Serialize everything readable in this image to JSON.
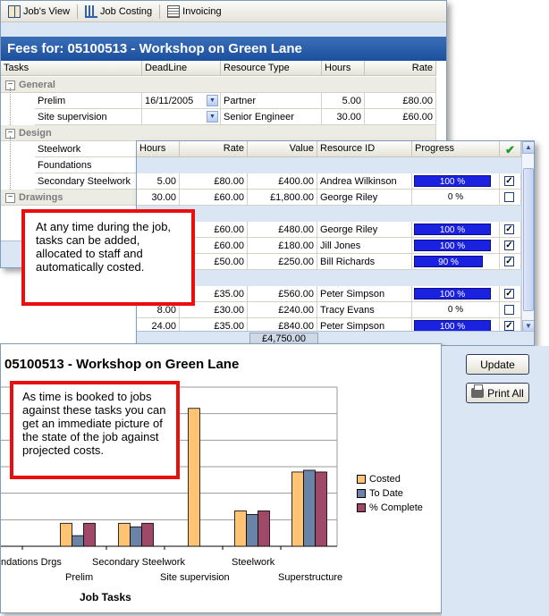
{
  "toolbar": {
    "jobs_view": "Job's View",
    "job_costing": "Job Costing",
    "invoicing": "Invoicing"
  },
  "fees": {
    "title": "Fees for:  05100513 - Workshop on Green Lane"
  },
  "job_grid": {
    "headers": {
      "tasks": "Tasks",
      "deadline": "DeadLine",
      "resource_type": "Resource Type",
      "hours": "Hours",
      "rate": "Rate"
    },
    "groups": {
      "general": "General",
      "design": "Design",
      "drawings": "Drawings"
    },
    "general_rows": [
      {
        "task": "Prelim",
        "deadline": "16/11/2005",
        "resource_type": "Partner",
        "hours": "5.00",
        "rate": "£80.00"
      },
      {
        "task": "Site supervision",
        "deadline": "",
        "resource_type": "Senior Engineer",
        "hours": "30.00",
        "rate": "£60.00"
      }
    ],
    "design_rows": [
      {
        "task": "Steelwork"
      },
      {
        "task": "Foundations"
      },
      {
        "task": "Secondary Steelwork"
      }
    ]
  },
  "resource_grid": {
    "headers": {
      "hours": "Hours",
      "rate": "Rate",
      "value": "Value",
      "resource_id": "Resource ID",
      "progress": "Progress"
    },
    "rows": [
      {
        "hours": "5.00",
        "rate": "£80.00",
        "value": "£400.00",
        "resource_id": "Andrea Wilkinson",
        "progress": "100 %",
        "progress_level": 1.0,
        "checked": true
      },
      {
        "hours": "30.00",
        "rate": "£60.00",
        "value": "£1,800.00",
        "resource_id": "George Riley",
        "progress": "0 %",
        "progress_level": 0.0,
        "checked": false
      },
      {
        "hours": "",
        "rate": "£60.00",
        "value": "£480.00",
        "resource_id": "George Riley",
        "progress": "100 %",
        "progress_level": 1.0,
        "checked": true
      },
      {
        "hours": "",
        "rate": "£60.00",
        "value": "£180.00",
        "resource_id": "Jill Jones",
        "progress": "100 %",
        "progress_level": 1.0,
        "checked": true
      },
      {
        "hours": "",
        "rate": "£50.00",
        "value": "£250.00",
        "resource_id": "Bill Richards",
        "progress": "90 %",
        "progress_level": 0.9,
        "checked": true
      },
      {
        "hours": "",
        "rate": "£35.00",
        "value": "£560.00",
        "resource_id": "Peter Simpson",
        "progress": "100 %",
        "progress_level": 1.0,
        "checked": true
      },
      {
        "hours": "8.00",
        "rate": "£30.00",
        "value": "£240.00",
        "resource_id": "Tracy Evans",
        "progress": "0 %",
        "progress_level": 0.0,
        "checked": false
      },
      {
        "hours": "24.00",
        "rate": "£35.00",
        "value": "£840.00",
        "resource_id": "Peter Simpson",
        "progress": "100 %",
        "progress_level": 1.0,
        "checked": true
      }
    ],
    "total": "£4,750.00"
  },
  "callouts": {
    "one": "At any time during the job, tasks can be added, allocated to staff and automatically costed.",
    "two": "As time is booked to jobs against these tasks you can get an immediate picture of the state of the job against projected costs."
  },
  "chart": {
    "title": "05100513 - Workshop on Green Lane",
    "xlabel": "Job Tasks",
    "categories_top": [
      "ndations Drgs",
      "Secondary Steelwork",
      "Steelwork"
    ],
    "categories_bottom": [
      "Prelim",
      "Site supervision",
      "Superstructure"
    ],
    "legend": [
      "Costed",
      "To Date",
      "% Complete"
    ],
    "colors": {
      "costed": "#ffc374",
      "to_date": "#6c83a8",
      "complete": "#a04868"
    }
  },
  "chart_data": {
    "type": "bar",
    "title": "05100513 - Workshop on Green Lane",
    "xlabel": "Job Tasks",
    "categories": [
      "Foundations Drgs",
      "Prelim",
      "Secondary Steelwork",
      "Site supervision",
      "Steelwork",
      "Superstructure"
    ],
    "series": [
      {
        "name": "Costed",
        "values": [
          20,
          13,
          13,
          78,
          20,
          42
        ]
      },
      {
        "name": "To Date",
        "values": [
          0,
          6,
          11,
          0,
          18,
          43
        ]
      },
      {
        "name": "% Complete",
        "values": [
          0,
          13,
          13,
          0,
          20,
          42
        ]
      }
    ],
    "ylim": [
      0,
      90
    ],
    "grid": true,
    "legend_position": "right"
  },
  "buttons": {
    "update": "Update",
    "print_all": "Print All"
  }
}
